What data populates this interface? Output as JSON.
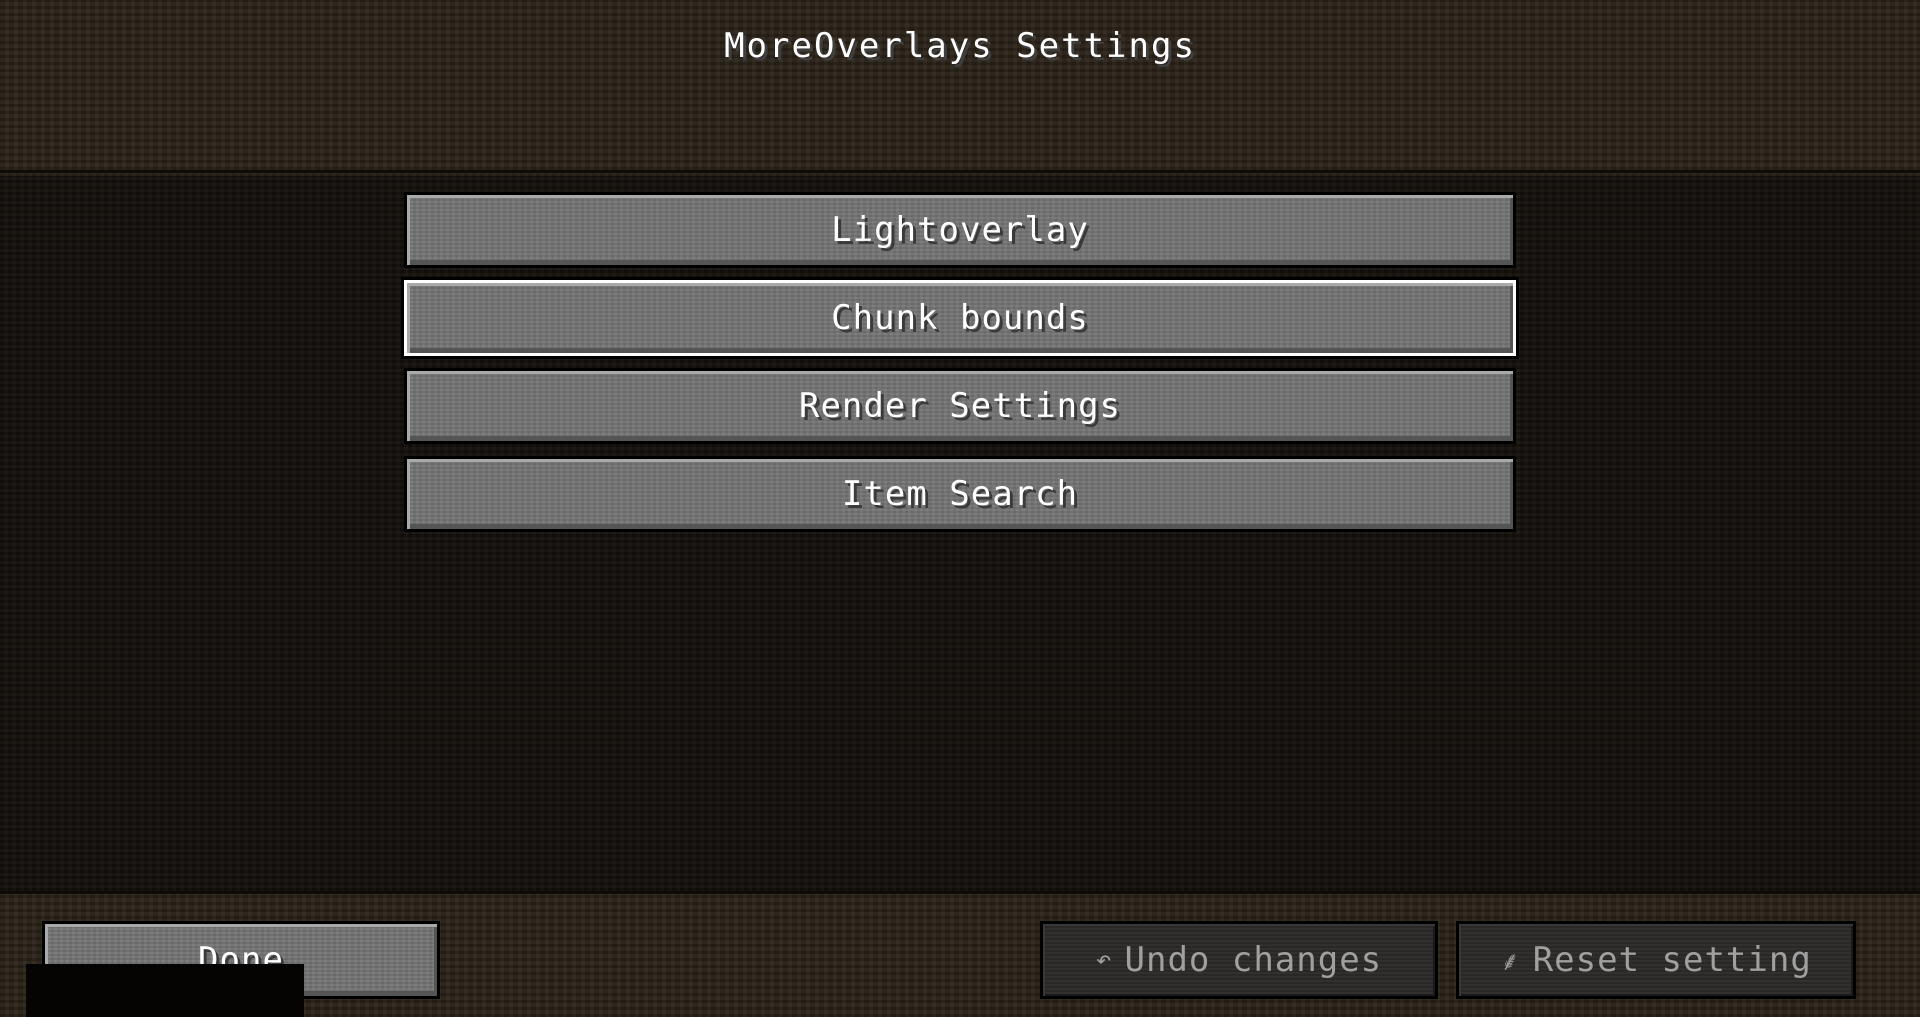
{
  "header": {
    "title": "MoreOverlays Settings"
  },
  "categories": [
    {
      "label": "Lightoverlay"
    },
    {
      "label": "Chunk bounds"
    },
    {
      "label": "Render Settings"
    },
    {
      "label": "Item Search"
    }
  ],
  "footer": {
    "done_label": "Done",
    "undo_label": "Undo changes",
    "undo_icon": "undo-arrow-icon",
    "reset_label": "Reset setting",
    "reset_icon": "broom-icon"
  },
  "colors": {
    "button_face": "#747474",
    "button_hover_border": "#ffffff",
    "text": "#ffffff",
    "disabled_text": "#a0a0a0"
  }
}
